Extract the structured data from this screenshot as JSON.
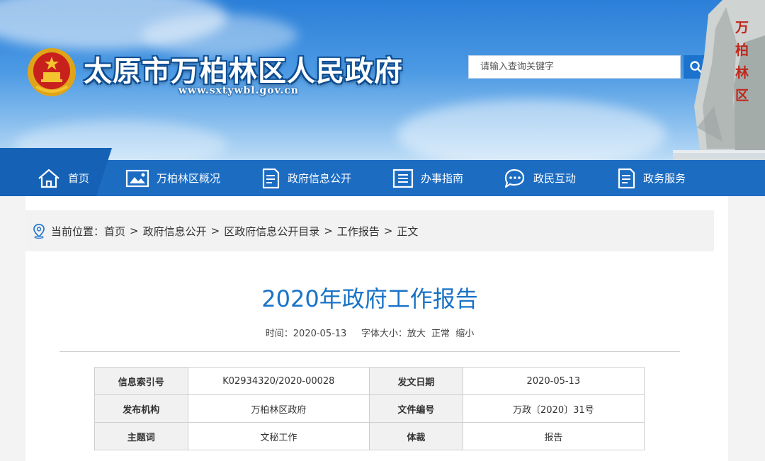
{
  "header": {
    "site_title": "太原市万柏林区人民政府",
    "site_url": "www.sxtywbl.gov.cn",
    "search_placeholder": "请输入查询关键字",
    "seal_text": [
      "万",
      "柏",
      "林",
      "区"
    ]
  },
  "nav": {
    "items": [
      {
        "label": "首页",
        "icon": "home-icon"
      },
      {
        "label": "万柏林区概况",
        "icon": "picture-icon"
      },
      {
        "label": "政府信息公开",
        "icon": "document-icon"
      },
      {
        "label": "办事指南",
        "icon": "list-icon"
      },
      {
        "label": "政民互动",
        "icon": "chat-icon"
      },
      {
        "label": "政务服务",
        "icon": "document-icon"
      }
    ]
  },
  "breadcrumb": {
    "prefix": "当前位置：",
    "items": [
      "首页",
      "政府信息公开",
      "区政府信息公开目录",
      "工作报告",
      "正文"
    ],
    "separator": ">"
  },
  "article": {
    "title": "2020年政府工作报告",
    "time_label": "时间：2020-05-13",
    "font_size_label": "字体大小：",
    "font_options": [
      "放大",
      "正常",
      "缩小"
    ]
  },
  "info_table": {
    "rows": [
      [
        {
          "key": "信息索引号",
          "value": "K02934320/2020-00028"
        },
        {
          "key": "发文日期",
          "value": "2020-05-13"
        }
      ],
      [
        {
          "key": "发布机构",
          "value": "万柏林区政府"
        },
        {
          "key": "文件编号",
          "value": "万政〔2020〕31号"
        }
      ],
      [
        {
          "key": "主题词",
          "value": "文秘工作"
        },
        {
          "key": "体裁",
          "value": "报告"
        }
      ]
    ]
  },
  "colors": {
    "nav_bg": "#1c6cc2",
    "accent": "#1a73c7",
    "search_button": "#1b73cd"
  }
}
